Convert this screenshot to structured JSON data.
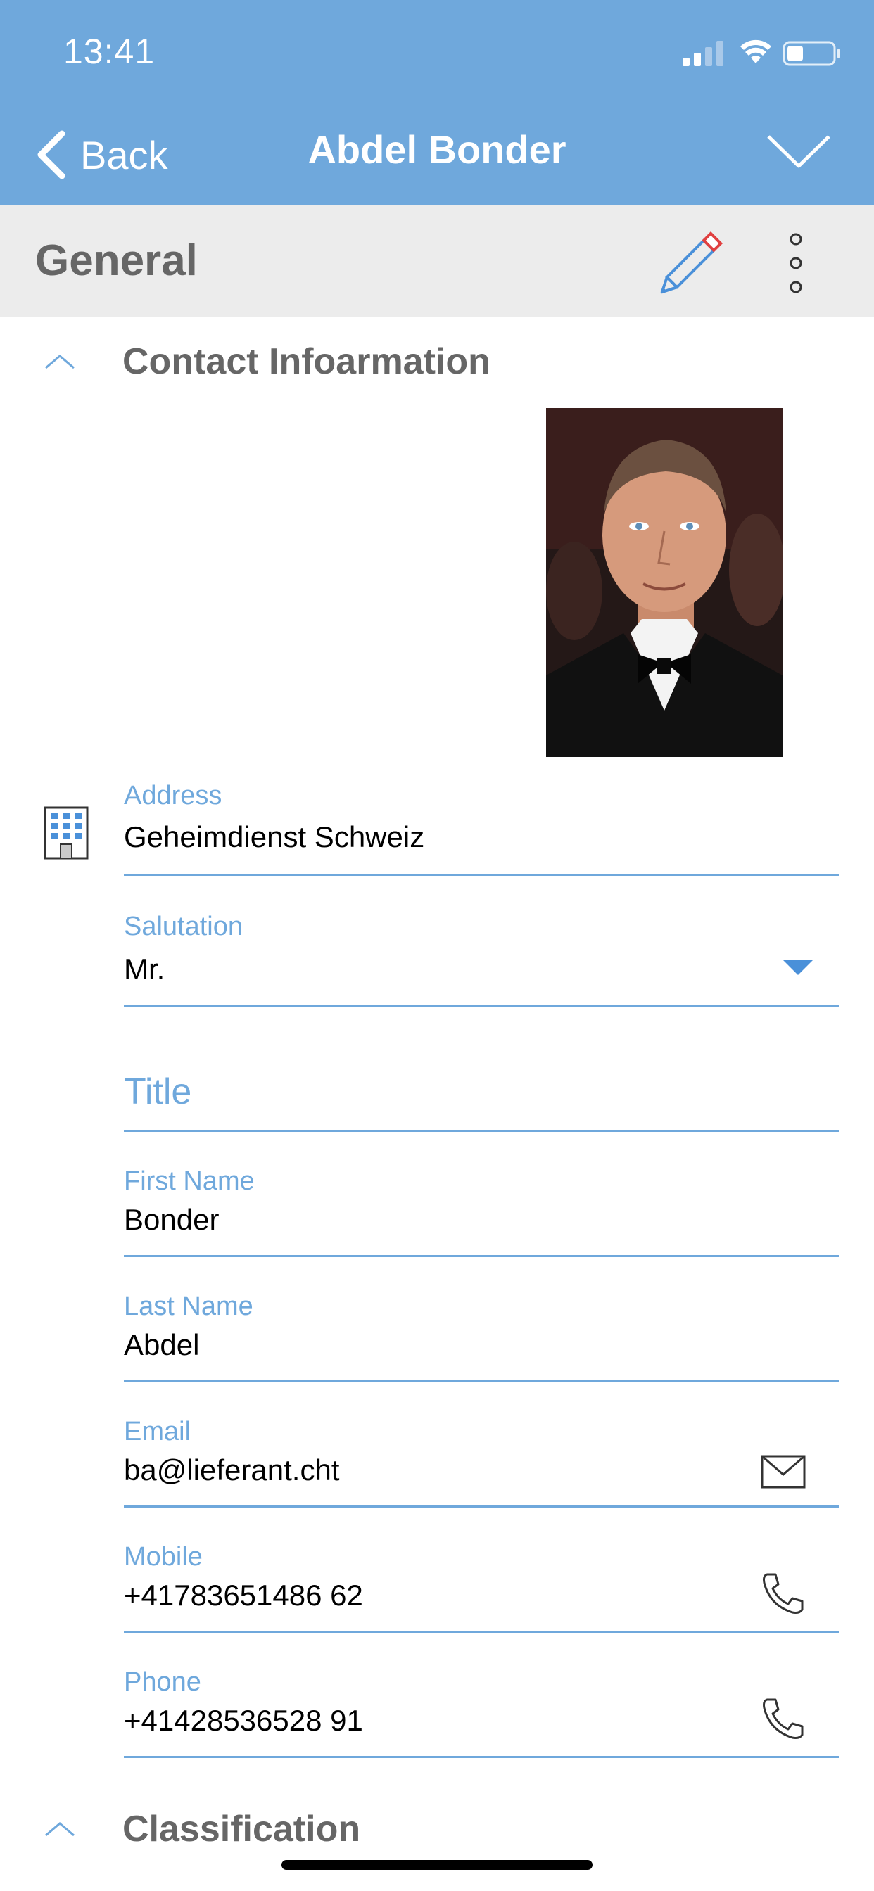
{
  "status_bar": {
    "time": "13:41"
  },
  "nav": {
    "back_label": "Back",
    "title": "Abdel Bonder"
  },
  "section": {
    "title": "General"
  },
  "contact_group": {
    "title": "Contact Infoarmation"
  },
  "fields": {
    "address": {
      "label": "Address",
      "value": "Geheimdienst Schweiz"
    },
    "salutation": {
      "label": "Salutation",
      "value": "Mr."
    },
    "title": {
      "placeholder": "Title"
    },
    "first_name": {
      "label": "First Name",
      "value": "Bonder"
    },
    "last_name": {
      "label": "Last Name",
      "value": "Abdel"
    },
    "email": {
      "label": "Email",
      "value": "ba@lieferant.cht"
    },
    "mobile": {
      "label": "Mobile",
      "value": "+41783651486 62"
    },
    "phone": {
      "label": "Phone",
      "value": "+41428536528 91"
    }
  },
  "classification_group": {
    "title": "Classification"
  },
  "colors": {
    "header_bg": "#6fa8dc",
    "accent": "#6fa8dc",
    "section_bar_bg": "#ececec",
    "section_text": "#666666"
  },
  "icons": [
    "back-chevron-icon",
    "chevron-down-icon",
    "pencil-icon",
    "more-vertical-icon",
    "chevron-up-icon",
    "building-icon",
    "dropdown-triangle-icon",
    "mail-icon",
    "phone-icon"
  ]
}
